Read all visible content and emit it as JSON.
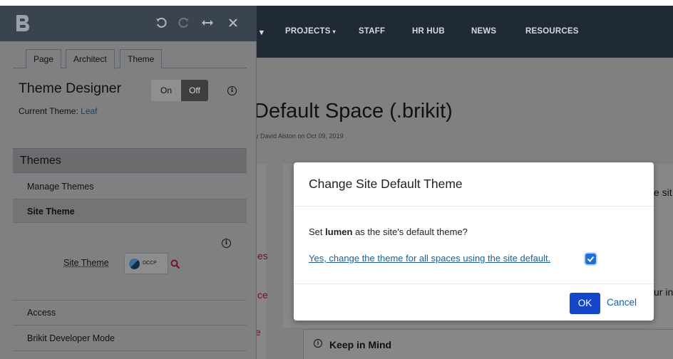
{
  "navbar": {
    "caret_only": "▾",
    "items": [
      {
        "label": "PROJECTS",
        "caret": "▾"
      },
      {
        "label": "STAFF"
      },
      {
        "label": "HR HUB"
      },
      {
        "label": "NEWS"
      },
      {
        "label": "RESOURCES"
      }
    ]
  },
  "page": {
    "title": "Default Space (.brikit)",
    "byline": "y David Alston on Oct 09, 2019",
    "fragments": {
      "es": "es",
      "ce": "ce",
      "e_mark": "e",
      "e_si": "e sit",
      "ur_in": "ur in"
    },
    "keep_in_mind": "Keep in Mind"
  },
  "panel": {
    "header_icons": [
      "undo-icon",
      "redo-icon",
      "resize-icon",
      "close-icon"
    ],
    "tabs": [
      {
        "label": "Page"
      },
      {
        "label": "Architect"
      },
      {
        "label": "Theme"
      }
    ],
    "theme_designer": {
      "title": "Theme Designer",
      "on_label": "On",
      "off_label": "Off"
    },
    "current_theme_label": "Current Theme:",
    "current_theme_value": "Leaf",
    "themes_section": "Themes",
    "menu": {
      "manage_themes": "Manage Themes",
      "site_theme": "Site Theme",
      "access": "Access",
      "dev_mode": "Brikit Developer Mode"
    },
    "site_theme_field_label": "Site Theme",
    "site_theme_chip": "DCCP"
  },
  "modal": {
    "title": "Change Site Default Theme",
    "question_prefix": "Set",
    "question_theme": "lumen",
    "question_suffix": "as the site's default theme?",
    "link_text": "Yes, change the theme for all spaces using the site default.",
    "checkbox_checked": true,
    "ok_label": "OK",
    "cancel_label": "Cancel"
  },
  "colors": {
    "navbar": "#1f2a36",
    "panel_header": "#3a4350",
    "ok_button": "#1346c9",
    "checkbox": "#1e6fd9",
    "link": "#1f5e8f",
    "search_icon": "#7a0f2a"
  }
}
